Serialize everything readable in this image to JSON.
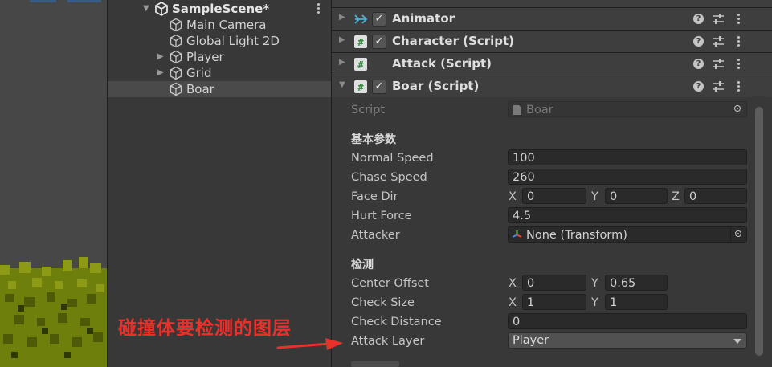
{
  "hierarchy": {
    "scene_name": "SampleScene*",
    "items": [
      {
        "label": "Main Camera"
      },
      {
        "label": "Global Light 2D"
      },
      {
        "label": "Player"
      },
      {
        "label": "Grid"
      },
      {
        "label": "Boar"
      }
    ]
  },
  "inspector": {
    "components": [
      {
        "title": "Animator",
        "icon": "animator-icon",
        "enabled": true
      },
      {
        "title": "Character (Script)",
        "icon": "script-icon",
        "enabled": true
      },
      {
        "title": "Attack (Script)",
        "icon": "script-icon",
        "enabled": false
      },
      {
        "title": "Boar (Script)",
        "icon": "script-icon",
        "enabled": true
      }
    ],
    "help_glyph": "?",
    "check_glyph": "✓",
    "boar": {
      "script_label": "Script",
      "script_value": "Boar",
      "section_basic": "基本参数",
      "normal_speed_label": "Normal Speed",
      "normal_speed": "100",
      "chase_speed_label": "Chase Speed",
      "chase_speed": "260",
      "face_dir_label": "Face Dir",
      "face_dir": {
        "x": "0",
        "y": "0",
        "z": "0"
      },
      "hurt_force_label": "Hurt Force",
      "hurt_force": "4.5",
      "attacker_label": "Attacker",
      "attacker_value": "None (Transform)",
      "section_check": "检测",
      "center_offset_label": "Center Offset",
      "center_offset": {
        "x": "0",
        "y": "0.65"
      },
      "check_size_label": "Check Size",
      "check_size": {
        "x": "1",
        "y": "1"
      },
      "check_distance_label": "Check Distance",
      "check_distance": "0",
      "attack_layer_label": "Attack Layer",
      "attack_layer": "Player"
    },
    "axis_labels": {
      "x": "X",
      "y": "Y",
      "z": "Z"
    }
  },
  "annotation": {
    "text": "碰撞体要检测的图层",
    "color": "#e8312b"
  },
  "colors": {
    "accent": "#3a5a86",
    "panel": "#383838",
    "field": "#2a2a2a",
    "grass": "#7d8c10"
  }
}
